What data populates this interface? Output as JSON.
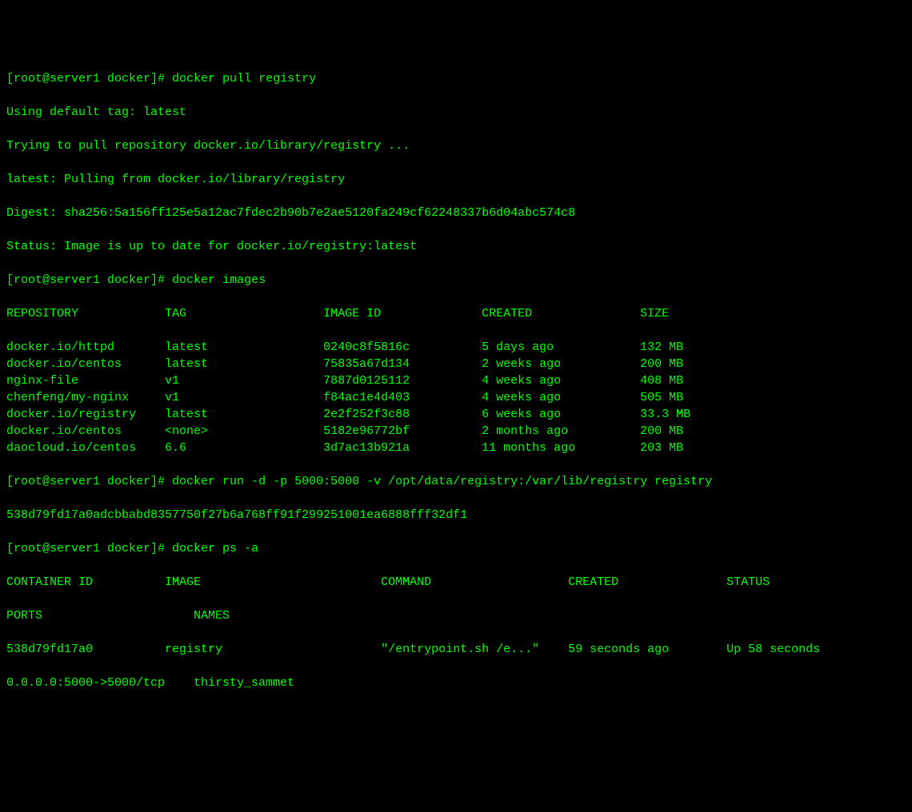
{
  "prompt": "[root@server1 docker]# ",
  "cmd1": "docker pull registry",
  "pull_output": {
    "line1": "Using default tag: latest",
    "line2": "Trying to pull repository docker.io/library/registry ...",
    "line3": "latest: Pulling from docker.io/library/registry",
    "line4": "Digest: sha256:5a156ff125e5a12ac7fdec2b90b7e2ae5120fa249cf62248337b6d04abc574c8",
    "line5": "Status: Image is up to date for docker.io/registry:latest"
  },
  "cmd2": "docker images",
  "images_header": {
    "repo": "REPOSITORY",
    "tag": "TAG",
    "id": "IMAGE ID",
    "created": "CREATED",
    "size": "SIZE"
  },
  "images": [
    {
      "repo": "docker.io/httpd",
      "tag": "latest",
      "id": "0240c8f5816c",
      "created": "5 days ago",
      "size": "132 MB"
    },
    {
      "repo": "docker.io/centos",
      "tag": "latest",
      "id": "75835a67d134",
      "created": "2 weeks ago",
      "size": "200 MB"
    },
    {
      "repo": "nginx-file",
      "tag": "v1",
      "id": "7887d0125112",
      "created": "4 weeks ago",
      "size": "408 MB"
    },
    {
      "repo": "chenfeng/my-nginx",
      "tag": "v1",
      "id": "f84ac1e4d403",
      "created": "4 weeks ago",
      "size": "505 MB"
    },
    {
      "repo": "docker.io/registry",
      "tag": "latest",
      "id": "2e2f252f3c88",
      "created": "6 weeks ago",
      "size": "33.3 MB"
    },
    {
      "repo": "docker.io/centos",
      "tag": "<none>",
      "id": "5182e96772bf",
      "created": "2 months ago",
      "size": "200 MB"
    },
    {
      "repo": "daocloud.io/centos",
      "tag": "6.6",
      "id": "3d7ac13b921a",
      "created": "11 months ago",
      "size": "203 MB"
    }
  ],
  "cmd3": "docker run -d -p 5000:5000 -v /opt/data/registry:/var/lib/registry registry",
  "run_output": "538d79fd17a0adcbbabd8357750f27b6a768ff91f299251001ea6888fff32df1",
  "cmd4": "docker ps -a",
  "ps_header": {
    "cid": "CONTAINER ID",
    "image": "IMAGE",
    "command": "COMMAND",
    "created": "CREATED",
    "status": "STATUS",
    "ports": "PORTS",
    "names": "NAMES"
  },
  "ps_row": {
    "cid": "538d79fd17a0",
    "image": "registry",
    "command": "\"/entrypoint.sh /e...\"",
    "created": "59 seconds ago",
    "status": "Up 58 seconds",
    "ports": "0.0.0.0:5000->5000/tcp",
    "names": "thirsty_sammet"
  }
}
